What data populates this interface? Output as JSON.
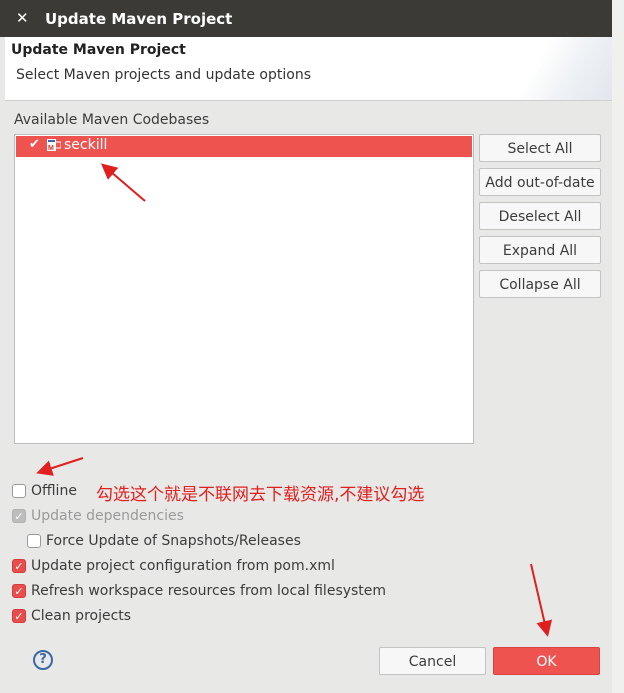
{
  "window": {
    "title": "Update Maven Project",
    "close_glyph": "✕"
  },
  "header": {
    "title": "Update Maven Project",
    "description": "Select Maven projects and update options"
  },
  "codebases": {
    "label": "Available Maven Codebases",
    "items": [
      {
        "name": "seckill",
        "checked": true,
        "icon": "maven-project-icon"
      }
    ]
  },
  "side_buttons": {
    "select_all": "Select All",
    "add_out_of_date": "Add out-of-date",
    "deselect_all": "Deselect All",
    "expand_all": "Expand All",
    "collapse_all": "Collapse All"
  },
  "options": {
    "offline": {
      "label": "Offline",
      "checked": false
    },
    "update_dependencies": {
      "label": "Update dependencies",
      "checked": true,
      "enabled": false
    },
    "force_update": {
      "label": "Force Update of Snapshots/Releases",
      "checked": false
    },
    "update_config": {
      "label": "Update project configuration from pom.xml",
      "checked": true
    },
    "refresh_workspace": {
      "label": "Refresh workspace resources from local filesystem",
      "checked": true
    },
    "clean_projects": {
      "label": "Clean projects",
      "checked": true
    }
  },
  "annotation": {
    "text": "勾选这个就是不联网去下载资源,不建议勾选",
    "color": "#e0201f"
  },
  "footer": {
    "help_glyph": "?",
    "cancel": "Cancel",
    "ok": "OK"
  },
  "colors": {
    "accent": "#ef5350",
    "titlebar": "#3b3a36"
  }
}
